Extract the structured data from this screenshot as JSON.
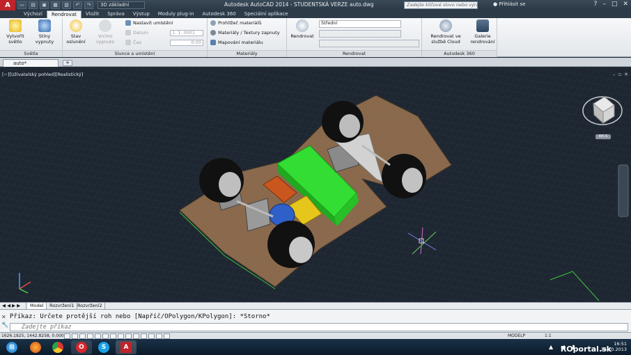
{
  "app": {
    "logo": "A",
    "workspace": "3D základní",
    "title": "Autodesk AutoCAD 2014 - STUDENTSKÁ VERZE    auto.dwg",
    "search_placeholder": "Zadejte klíčové slovo nebo výraz.",
    "login_label": "Přihlásit se",
    "help_label": "?"
  },
  "ribbon_tabs": [
    {
      "label": "Výchozí",
      "active": false
    },
    {
      "label": "Rendrovat",
      "active": true
    },
    {
      "label": "Vložit",
      "active": false
    },
    {
      "label": "Správa",
      "active": false
    },
    {
      "label": "Výstup",
      "active": false
    },
    {
      "label": "Moduly plug-in",
      "active": false
    },
    {
      "label": "Autodesk 360",
      "active": false
    },
    {
      "label": "Speciální aplikace",
      "active": false
    }
  ],
  "ribbon": {
    "lights_panel": {
      "title": "Světla",
      "create_light": "Vytvořit světlo",
      "shadows_off": "Stíny vypnuty"
    },
    "sun_panel": {
      "title": "Slunce a umístění",
      "sun_status": "Stav oslunění",
      "sky_off": "Vrchní vypnuto",
      "set_location": "Nastavit umístění",
      "date_label": "Datum",
      "date_value": "1. 1. 0001",
      "time_label": "Čas",
      "time_value": "0:00"
    },
    "materials_panel": {
      "title": "Materiály",
      "browser": "Prohlížeč materiálů",
      "textures": "Materiály / Textury zapnuty",
      "mapping": "Mapování materiálu"
    },
    "render_panel": {
      "title": "Rendrovat",
      "render": "Rendrovat",
      "quality": "Střední"
    },
    "a360_panel": {
      "title": "Autodesk 360",
      "cloud_render": "Rendrovat ve službě Cloud",
      "gallery": "Galerie rendrování"
    }
  },
  "document": {
    "tab": "auto*"
  },
  "viewport": {
    "label": "[−][Uživatelský pohled][Realistický]",
    "cube_label": "WCS"
  },
  "layout_tabs": [
    "Model",
    "Rozvržení1",
    "Rozvržení2"
  ],
  "command": {
    "history": "Příkaz: Určete protější roh nebo [Napříč/OPolygon/KPolygon]: *Storno*",
    "placeholder": "Zadejte příkaz"
  },
  "status": {
    "coords": "1626.1825, 1442.8258, 0.0000",
    "modelp": "MODELP",
    "scale": "1:1"
  },
  "taskbar": {
    "time": "16:51",
    "date": "26.10.2013",
    "watermark": "ROportal.sk"
  },
  "colors": {
    "accent_red": "#c0242a",
    "board": "#8a6a4e",
    "green_block": "#2fd62f",
    "yellow_block": "#e6c61a",
    "blue_block": "#2f5fc9",
    "orange_block": "#c8561d"
  }
}
